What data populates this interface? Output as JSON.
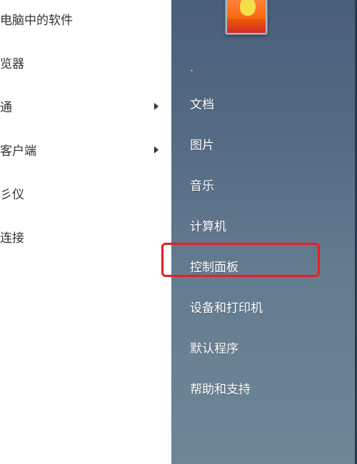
{
  "left": {
    "items": [
      {
        "label": "电脑中的软件",
        "hasArrow": false
      },
      {
        "label": "览器",
        "hasArrow": false
      },
      {
        "label": "通",
        "hasArrow": true
      },
      {
        "label": "客户端",
        "hasArrow": true
      },
      {
        "label": "彡仪",
        "hasArrow": false
      },
      {
        "label": "连接",
        "hasArrow": false
      }
    ]
  },
  "right": {
    "dot": "·",
    "items": [
      {
        "label": "文档"
      },
      {
        "label": "图片"
      },
      {
        "label": "音乐"
      },
      {
        "label": "计算机"
      },
      {
        "label": "控制面板",
        "highlighted": true
      },
      {
        "label": "设备和打印机"
      },
      {
        "label": "默认程序"
      },
      {
        "label": "帮助和支持"
      }
    ]
  }
}
